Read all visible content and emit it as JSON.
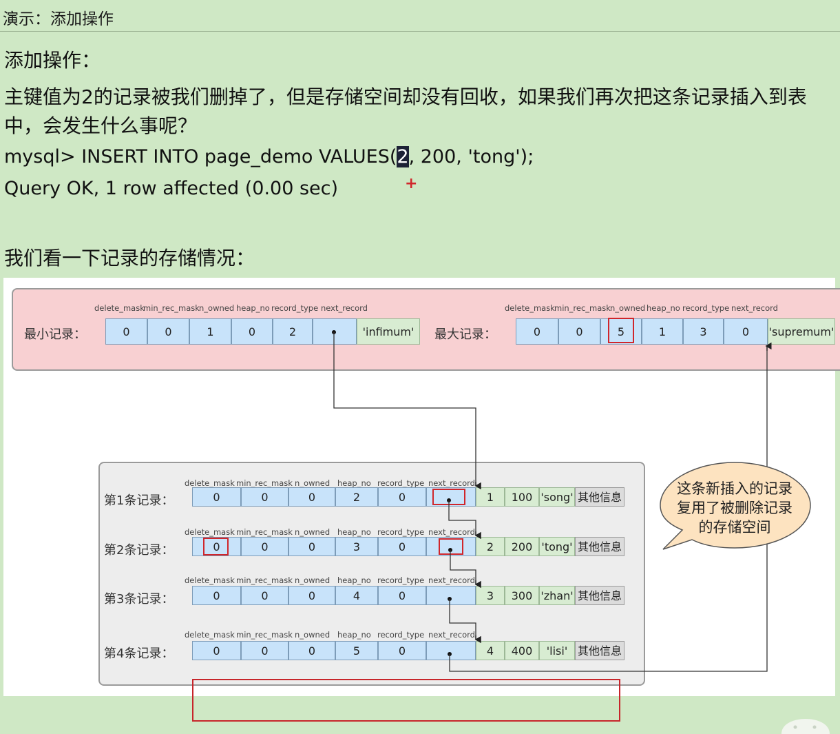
{
  "title": "演示：添加操作",
  "heading_add": "添加操作：",
  "paragraph": "主键值为2的记录被我们删掉了，但是存储空间却没有回收，如果我们再次把这条记录插入到表中，会发生什么事呢？",
  "code": {
    "before": "mysql> INSERT INTO page_demo VALUES(",
    "highlight": "2",
    "after": ", 200, 'tong');"
  },
  "result": "Query OK, 1 row affected (0.00 sec)",
  "plus": "+",
  "heading_see": "我们看一下记录的存储情况：",
  "header_fields": {
    "delete_mask": "delete_mask",
    "min_rec_mask": "min_rec_mask",
    "n_owned": "n_owned",
    "heap_no": "heap_no",
    "record_type": "record_type",
    "next_record": "next_record"
  },
  "infimum": {
    "label": "最小记录：",
    "values": [
      "0",
      "0",
      "1",
      "0",
      "2"
    ],
    "name": "'infimum'"
  },
  "supremum": {
    "label": "最大记录：",
    "values": [
      "0",
      "0",
      "5",
      "1",
      "3",
      "0"
    ],
    "name": "'supremum'"
  },
  "records": [
    {
      "label": "第1条记录：",
      "values": [
        "0",
        "0",
        "0",
        "2",
        "0"
      ],
      "id": "1",
      "num": "100",
      "str": "'song'",
      "other": "其他信息"
    },
    {
      "label": "第2条记录：",
      "values": [
        "0",
        "0",
        "0",
        "3",
        "0"
      ],
      "id": "2",
      "num": "200",
      "str": "'tong'",
      "other": "其他信息"
    },
    {
      "label": "第3条记录：",
      "values": [
        "0",
        "0",
        "0",
        "4",
        "0"
      ],
      "id": "3",
      "num": "300",
      "str": "'zhan'",
      "other": "其他信息"
    },
    {
      "label": "第4条记录：",
      "values": [
        "0",
        "0",
        "0",
        "5",
        "0"
      ],
      "id": "4",
      "num": "400",
      "str": "'lisi'",
      "other": "其他信息"
    }
  ],
  "callout": [
    "这条新插入的记录",
    "复用了被删除记录",
    "的存储空间"
  ],
  "colors": {
    "background": "#cfe8c5",
    "bound_bg": "#f8d0d2",
    "cell_blue": "#c8e3fa",
    "cell_green": "#d8ecd2",
    "callout": "#fde3c0",
    "highlight_red": "#d0262b"
  }
}
